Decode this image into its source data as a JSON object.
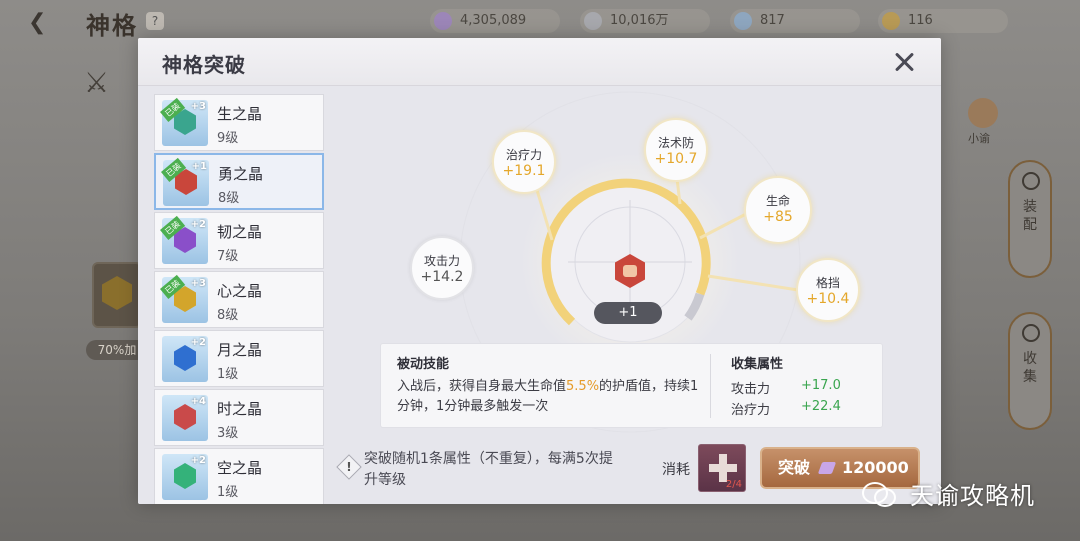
{
  "background": {
    "page_title": "神格",
    "help_label": "?",
    "resources": [
      {
        "icon": "gem-purple-icon",
        "value": "4,305,089"
      },
      {
        "icon": "coin-silver-icon",
        "value": "10,016万"
      },
      {
        "icon": "crystal-blue-icon",
        "value": "817"
      },
      {
        "icon": "coin-gold-icon",
        "value": "116"
      }
    ],
    "avatar_label": "小谕",
    "side_buttons": [
      "装配",
      "收集"
    ],
    "left_badge": "70%加"
  },
  "modal": {
    "title": "神格突破",
    "close_icon": "close-icon"
  },
  "crystals": [
    {
      "name": "生之晶",
      "level": "9级",
      "tag": "已装",
      "plus": "+3",
      "color": "#3aa58e",
      "selected": false
    },
    {
      "name": "勇之晶",
      "level": "8级",
      "tag": "已装",
      "plus": "+1",
      "color": "#c9463b",
      "selected": true
    },
    {
      "name": "韧之晶",
      "level": "7级",
      "tag": "已装",
      "plus": "+2",
      "color": "#8a4fc9",
      "selected": false
    },
    {
      "name": "心之晶",
      "level": "8级",
      "tag": "已装",
      "plus": "+3",
      "color": "#d3a52b",
      "selected": false
    },
    {
      "name": "月之晶",
      "level": "1级",
      "tag": "",
      "plus": "+2",
      "color": "#2f6fd0",
      "selected": false
    },
    {
      "name": "时之晶",
      "level": "3级",
      "tag": "",
      "plus": "+4",
      "color": "#c94a4a",
      "selected": false
    },
    {
      "name": "空之晶",
      "level": "1级",
      "tag": "",
      "plus": "+2",
      "color": "#34b27a",
      "selected": false
    }
  ],
  "attributes": {
    "attack": {
      "label": "攻击力",
      "value": "+14.2"
    },
    "heal": {
      "label": "治疗力",
      "value": "+19.1"
    },
    "mdef": {
      "label": "法术防",
      "value": "+10.7"
    },
    "hp": {
      "label": "生命",
      "value": "+85"
    },
    "block": {
      "label": "格挡",
      "value": "+10.4"
    }
  },
  "level_pill": "+1",
  "passive": {
    "title": "被动技能",
    "desc_before": "入战后，获得自身最大生命值",
    "desc_highlight": "5.5%",
    "desc_after": "的护盾值，持续1分钟，1分钟最多触发一次"
  },
  "collection": {
    "title": "收集属性",
    "stats": [
      {
        "name": "攻击力",
        "value": "+17.0"
      },
      {
        "name": "治疗力",
        "value": "+22.4"
      }
    ]
  },
  "note": "突破随机1条属性（不重复），每满5次提升等级",
  "cost": {
    "label": "消耗",
    "item_count": "2/4"
  },
  "break_button": {
    "label": "突破",
    "amount": "120000"
  },
  "watermark": "天谕攻略机",
  "colors": {
    "accent_gold": "#e4a72b",
    "green_stat": "#3aa54f",
    "button_brown": "#b07447",
    "highlight_orange": "#e59b2a"
  }
}
